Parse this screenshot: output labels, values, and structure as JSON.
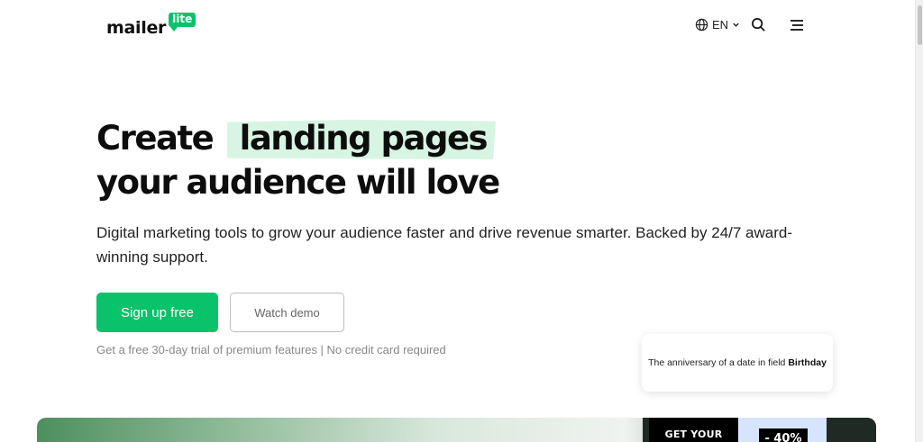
{
  "header": {
    "logo_word": "mailer",
    "logo_badge": "lite",
    "language": "EN",
    "icons": [
      "globe-icon",
      "chevron-down-icon",
      "search-icon",
      "menu-icon"
    ]
  },
  "hero": {
    "headline_prefix": "Create",
    "headline_highlight": "landing pages",
    "headline_line2": "your audience will love",
    "subtitle": "Digital marketing tools to grow your audience faster and drive revenue smarter. Backed by 24/7 award-winning support.",
    "primary_button": "Sign up free",
    "secondary_button": "Watch demo",
    "trial_note": "Get a free 30-day trial of premium features | No credit card required"
  },
  "floating_card": {
    "text": "The anniversary of a date in field",
    "field": "Birthday"
  },
  "banner": {
    "promo_text": "GET YOUR",
    "promo_discount": "- 40%"
  },
  "colors": {
    "brand_green": "#09c269",
    "highlight": "#d7f5e2",
    "text_dark": "#0d0d0d"
  }
}
